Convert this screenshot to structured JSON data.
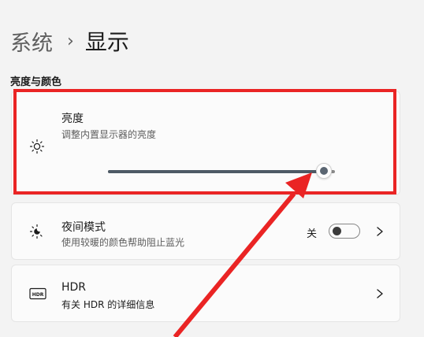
{
  "breadcrumb": {
    "parent": "系统",
    "separator": "›",
    "current": "显示"
  },
  "section": {
    "title": "亮度与颜色"
  },
  "brightness": {
    "title": "亮度",
    "description": "调整内置显示器的亮度",
    "icon": "sun-icon",
    "level_percent": 95
  },
  "night_light": {
    "title": "夜间模式",
    "description": "使用较暖的颜色帮助阻止蓝光",
    "icon": "night-light-icon",
    "state_label": "关",
    "enabled": false
  },
  "hdr": {
    "title": "HDR",
    "description": "有关 HDR 的详细信息",
    "icon": "hdr-icon",
    "badge_text": "HDR"
  },
  "annotation": {
    "color": "#ea2424"
  }
}
